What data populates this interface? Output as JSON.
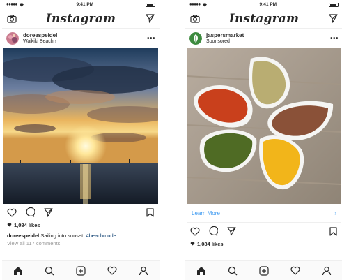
{
  "left": {
    "status": {
      "time": "9:41 PM"
    },
    "app": {
      "title": "Instagram"
    },
    "post": {
      "username": "doreespeidel",
      "location": "Waikiki Beach",
      "likes": "1,084 likes",
      "caption_user": "doreespeidel",
      "caption_text": "Sailing into sunset.",
      "hashtag": "#beachmode",
      "comments": "View all 117 comments"
    }
  },
  "right": {
    "status": {
      "time": "9:41 PM"
    },
    "app": {
      "title": "Instagram"
    },
    "post": {
      "username": "jaspersmarket",
      "sponsored": "Sponsored",
      "cta": "Learn More",
      "likes": "1,084 likes"
    }
  },
  "colors": {
    "link": "#3897f0",
    "hashtag": "#003569",
    "brand_green": "#3c8a3e",
    "muted": "#999999"
  },
  "icons": [
    "camera-icon",
    "send-icon",
    "more-icon",
    "heart-icon",
    "comment-icon",
    "bookmark-icon",
    "home-icon",
    "search-icon",
    "add-icon",
    "activity-heart-icon",
    "profile-icon",
    "chevron-right-icon"
  ]
}
